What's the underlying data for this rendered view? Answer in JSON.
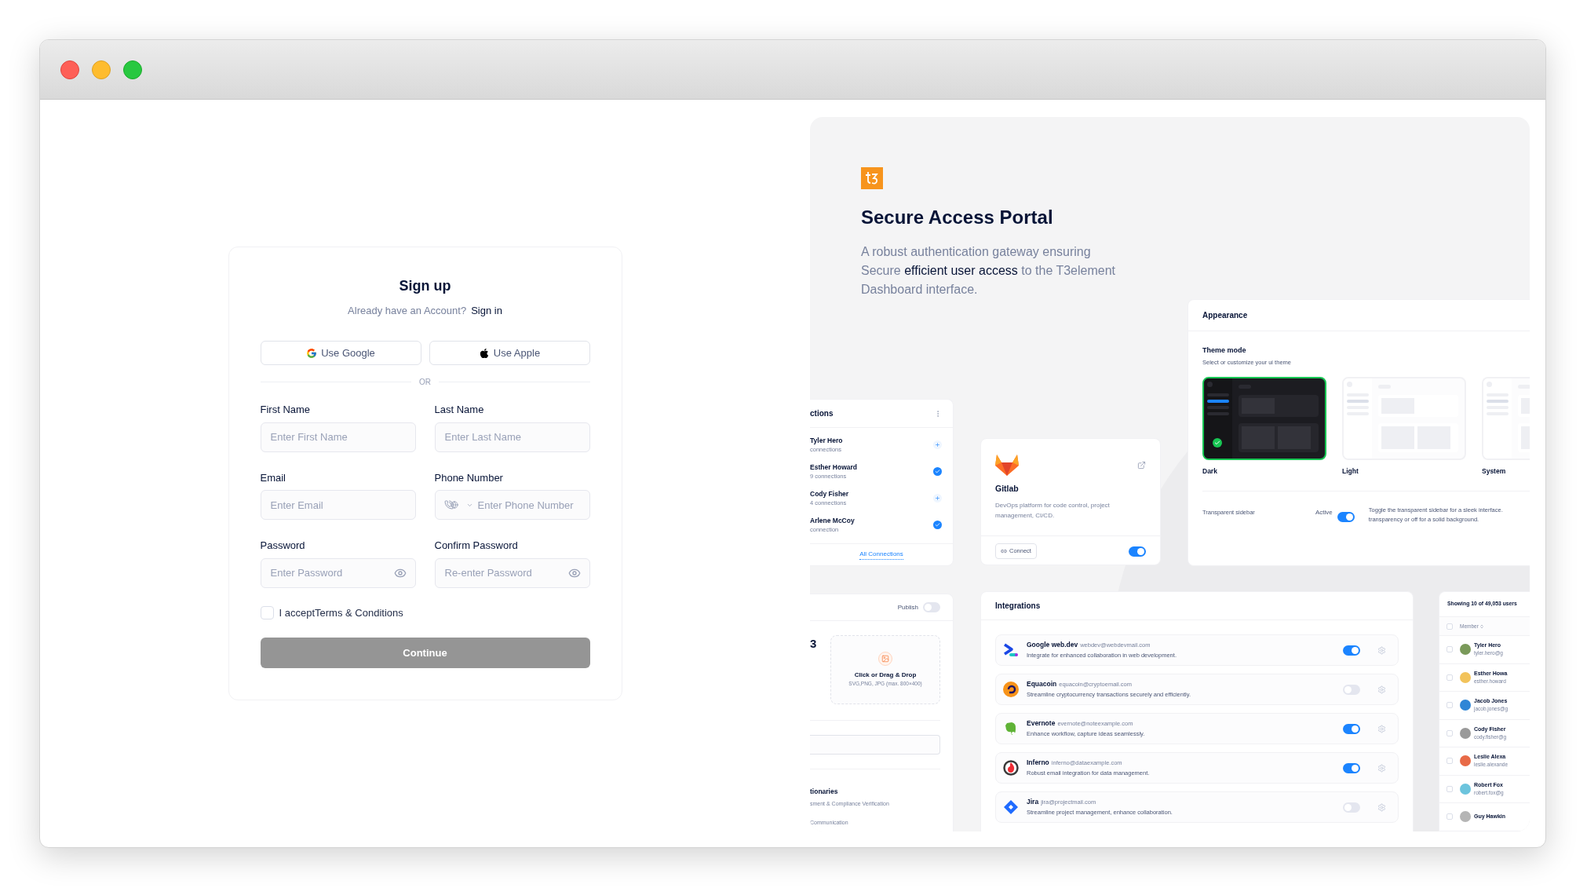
{
  "signup": {
    "title": "Sign up",
    "prompt": "Already have an Account?",
    "signin_link": "Sign in",
    "social_buttons": [
      {
        "kind": "google",
        "label": "Use Google"
      },
      {
        "kind": "apple",
        "label": "Use Apple"
      }
    ],
    "divider": "OR",
    "fields": [
      {
        "kind": "text",
        "label": "First Name",
        "placeholder": "Enter First Name"
      },
      {
        "kind": "text",
        "label": "Last Name",
        "placeholder": "Enter Last Name"
      },
      {
        "kind": "text",
        "label": "Email",
        "placeholder": "Enter Email"
      },
      {
        "kind": "phone",
        "label": "Phone Number",
        "placeholder": "Enter Phone Number"
      },
      {
        "kind": "password",
        "label": "Password",
        "placeholder": "Enter Password"
      },
      {
        "kind": "password",
        "label": "Confirm Password",
        "placeholder": "Re-enter Password"
      }
    ],
    "terms": {
      "label": "I acceptTerms & Conditions",
      "checked": false
    },
    "submit": {
      "label": "Continue",
      "disabled": true
    }
  },
  "portal": {
    "title": "Secure Access Portal",
    "description": "A robust authentication gateway ensuring Secure **efficient user access** to the T3element Dashboard interface."
  },
  "connections_card": {
    "title": "ctions",
    "rows": [
      {
        "name": "Tyler Hero",
        "detail": "connections",
        "connected": false
      },
      {
        "name": "Esther Howard",
        "detail": "9 connections",
        "connected": true
      },
      {
        "name": "Cody Fisher",
        "detail": "4 connections",
        "connected": false
      },
      {
        "name": "Arlene McCoy",
        "detail": "connection",
        "connected": true
      }
    ],
    "footer_link": "All Connections"
  },
  "gitlab_card": {
    "name": "Gitlab",
    "description": "DevOps platform for code control, project management, CI/CD.",
    "button": "Connect",
    "on": true
  },
  "appearance_card": {
    "title": "Appearance",
    "section_title": "Theme mode",
    "section_hint": "Select or customize your ui theme",
    "themes": [
      {
        "kind": "dark",
        "label": "Dark",
        "selected": true
      },
      {
        "kind": "light",
        "label": "Light",
        "selected": false
      },
      {
        "kind": "system",
        "label": "System",
        "selected": false
      }
    ],
    "setting": {
      "label": "Transparent sidebar",
      "status": "Active",
      "on": true,
      "description_lines": [
        "Toggle the transparent sidebar for a sleek interface.",
        "transparency or off for a solid background."
      ]
    }
  },
  "upload_card": {
    "publish_label": "Publish",
    "publish_on": false,
    "value_fragment": "3",
    "upload_title": "Click or Drag & Drop",
    "upload_hint": "SVG,PNG, JPG (max. 800×400)",
    "item_title": "tionaries",
    "item_detail": "sment & Compliance Verification",
    "item_next": "Communication"
  },
  "integrations_card": {
    "title": "Integrations",
    "items": [
      {
        "kind": "webdev",
        "name": "Google web.dev",
        "email": "webdev@webdevmail.com",
        "description": "Integrate for enhanced collaboration in web development.",
        "on": true
      },
      {
        "kind": "equacoin",
        "name": "Equacoin",
        "email": "equacoin@cryptoemail.com",
        "description": "Streamline cryptocurrency transactions securely and efficiently.",
        "on": false
      },
      {
        "kind": "evernote",
        "name": "Evernote",
        "email": "evernote@noteexample.com",
        "description": "Enhance workflow, capture ideas seamlessly.",
        "on": true
      },
      {
        "kind": "inferno",
        "name": "Inferno",
        "email": "inferno@dataexample.com",
        "description": "Robust email integration for data management.",
        "on": true
      },
      {
        "kind": "jira",
        "name": "Jira",
        "email": "jira@projectmail.com",
        "description": "Streamline project management, enhance collaboration.",
        "on": false
      }
    ]
  },
  "users_card": {
    "summary": "Showing 10 of 49,053 users",
    "column": "Member",
    "header_checked": false,
    "rows": [
      {
        "name": "Tyler Hero",
        "email": "tyler.hero@g",
        "checked": false,
        "color": "#7a9a5a"
      },
      {
        "name": "Esther Howa",
        "email": "esther.howard",
        "checked": false,
        "color": "#f2c35b"
      },
      {
        "name": "Jacob Jones",
        "email": "jacob.jones@g",
        "checked": false,
        "color": "#2f86d6"
      },
      {
        "name": "Cody Fisher",
        "email": "cody.fisher@g",
        "checked": false,
        "color": "#9a9a9a"
      },
      {
        "name": "Leslie Alexa",
        "email": "leslie.alexande",
        "checked": false,
        "color": "#e86a47"
      },
      {
        "name": "Robert Fox",
        "email": "robert.fox@g",
        "checked": false,
        "color": "#6cc4dd"
      },
      {
        "name": "Guy Hawkin",
        "checked": false,
        "color": "#b5b5b5"
      }
    ]
  }
}
